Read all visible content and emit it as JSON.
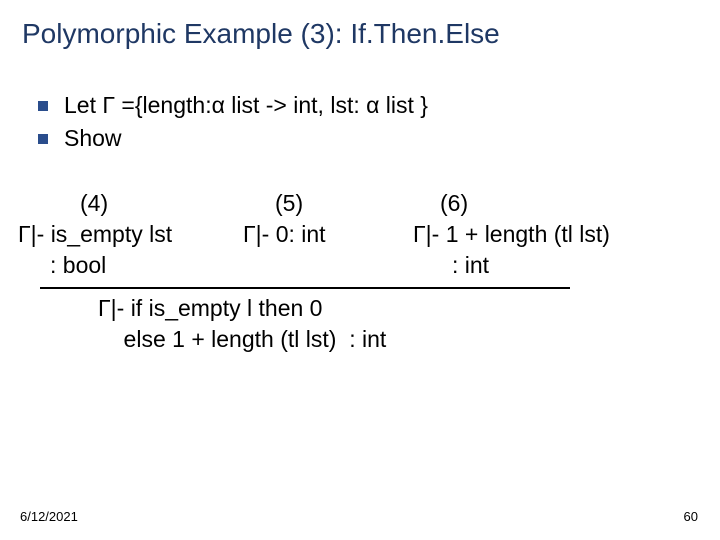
{
  "title": "Polymorphic Example (3): If.Then.Else",
  "bullets": {
    "b1": "Let  Γ ={length:α list -> int,  lst: α list }",
    "b2": "Show"
  },
  "labels": {
    "l4": "(4)",
    "l5": "(5)",
    "l6": "(6)"
  },
  "premises": {
    "p1": "Γ|- is_empty lst",
    "p2": "Γ|- 0: int",
    "p3": "Γ|- 1 + length (tl lst)"
  },
  "types": {
    "t1": ": bool",
    "t2": ": int"
  },
  "conclusion": {
    "line1": "Γ|- if is_empty l then 0",
    "line2": "    else 1 + length (tl lst)  : int"
  },
  "footer": {
    "date": "6/12/2021",
    "page": "60"
  }
}
